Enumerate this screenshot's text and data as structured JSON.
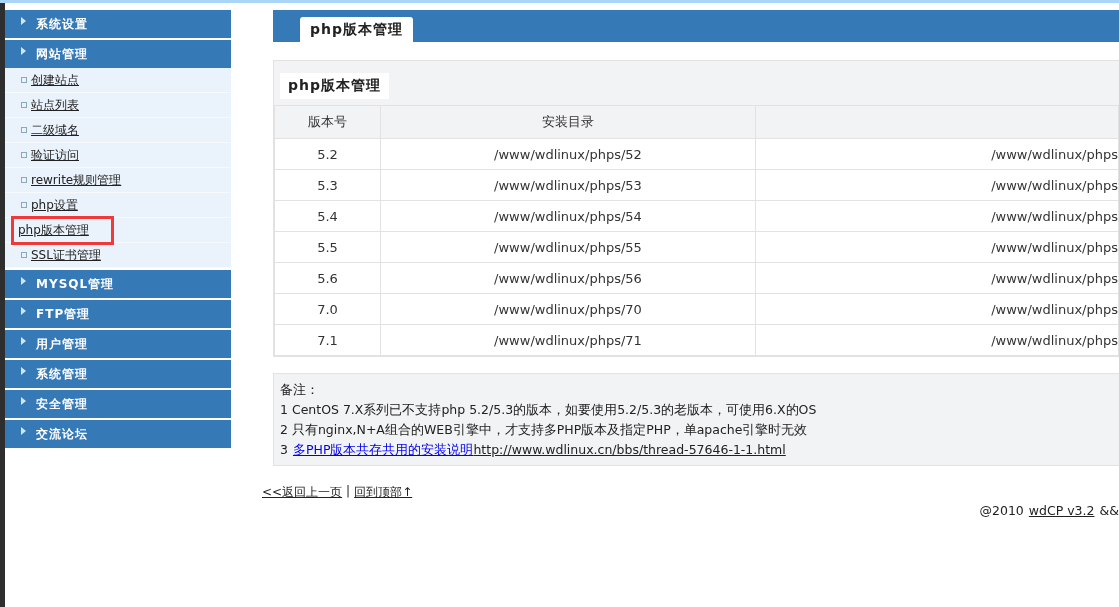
{
  "sidebar": {
    "groups": [
      {
        "title": "系统设置"
      },
      {
        "title": "网站管理",
        "items": [
          {
            "label": "创建站点",
            "selected": false
          },
          {
            "label": "站点列表",
            "selected": false
          },
          {
            "label": "二级域名",
            "selected": false
          },
          {
            "label": "验证访问",
            "selected": false
          },
          {
            "label": "rewrite规则管理",
            "selected": false
          },
          {
            "label": "php设置",
            "selected": false
          },
          {
            "label": "php版本管理",
            "selected": true
          },
          {
            "label": "SSL证书管理",
            "selected": false
          }
        ]
      },
      {
        "title": "MYSQL管理"
      },
      {
        "title": "FTP管理"
      },
      {
        "title": "用户管理"
      },
      {
        "title": "系统管理"
      },
      {
        "title": "安全管理"
      },
      {
        "title": "交流论坛"
      }
    ]
  },
  "header": {
    "tab": "php版本管理"
  },
  "panel": {
    "title": "php版本管理",
    "table": {
      "columns": [
        "版本号",
        "安装目录"
      ],
      "rows": [
        [
          "5.2",
          "/www/wdlinux/phps/52",
          "/www/wdlinux/phps"
        ],
        [
          "5.3",
          "/www/wdlinux/phps/53",
          "/www/wdlinux/phps"
        ],
        [
          "5.4",
          "/www/wdlinux/phps/54",
          "/www/wdlinux/phps"
        ],
        [
          "5.5",
          "/www/wdlinux/phps/55",
          "/www/wdlinux/phps"
        ],
        [
          "5.6",
          "/www/wdlinux/phps/56",
          "/www/wdlinux/phps"
        ],
        [
          "7.0",
          "/www/wdlinux/phps/70",
          "/www/wdlinux/phps"
        ],
        [
          "7.1",
          "/www/wdlinux/phps/71",
          "/www/wdlinux/phps"
        ]
      ]
    },
    "notes": {
      "title": "备注：",
      "lines": [
        {
          "text": "1 CentOS 7.X系列已不支持php 5.2/5.3的版本，如要使用5.2/5.3的老版本，可使用6.X的OS"
        },
        {
          "text": "2 只有nginx,N+A组合的WEB引擎中，才支持多PHP版本及指定PHP，单apache引擎时无效"
        },
        {
          "prefix": "3",
          "link": "多PHP版本共存共用的安装说明",
          "url": "http://www.wdlinux.cn/bbs/thread-57646-1-1.html"
        }
      ]
    }
  },
  "nav_links": {
    "back": "<<返回上一页",
    "separator": "|",
    "top": "回到顶部↑"
  },
  "footer": {
    "copyright": "@2010",
    "product_link": "wdCP v3.2",
    "tail": "&&"
  }
}
